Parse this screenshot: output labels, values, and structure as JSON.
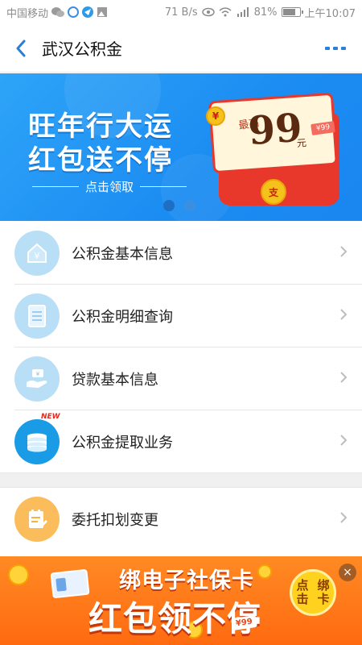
{
  "status_bar": {
    "carrier": "中国移动",
    "net_speed": "71 B/s",
    "battery": "81%",
    "battery_level": 0.81,
    "time": "上午10:07"
  },
  "nav": {
    "title": "武汉公积金",
    "back_icon": "chevron-left-icon",
    "more_icon": "more-dots-icon"
  },
  "banner": {
    "line1": "旺年行大运",
    "line2": "红包送不停",
    "cta": "点击领取",
    "envelope_small": "最高",
    "envelope_amount": "99",
    "envelope_unit": "元",
    "tag_text": "¥99",
    "coin_text": "支",
    "carousel_pages": 2,
    "carousel_active": 1
  },
  "menu": [
    {
      "label": "公积金基本信息",
      "icon": "house-yuan-icon",
      "color": "#b9dff7"
    },
    {
      "label": "公积金明细查询",
      "icon": "document-list-icon",
      "color": "#b9dff7"
    },
    {
      "label": "贷款基本信息",
      "icon": "hand-money-icon",
      "color": "#b9dff7"
    },
    {
      "label": "公积金提取业务",
      "icon": "coins-stack-icon",
      "color": "#1a9be6",
      "badge": "NEW"
    }
  ],
  "menu2": [
    {
      "label": "委托扣划变更",
      "icon": "edit-document-icon",
      "color": "#fbbd5b"
    }
  ],
  "ad": {
    "line1": "绑电子社保卡",
    "line2": "红包领不停",
    "button": "点击绑卡",
    "amount_tag": "¥99",
    "close_icon": "close-icon"
  },
  "colors": {
    "accent": "#2a7fd6",
    "banner": "#1b8cf2",
    "ad": "#ff7a18"
  }
}
